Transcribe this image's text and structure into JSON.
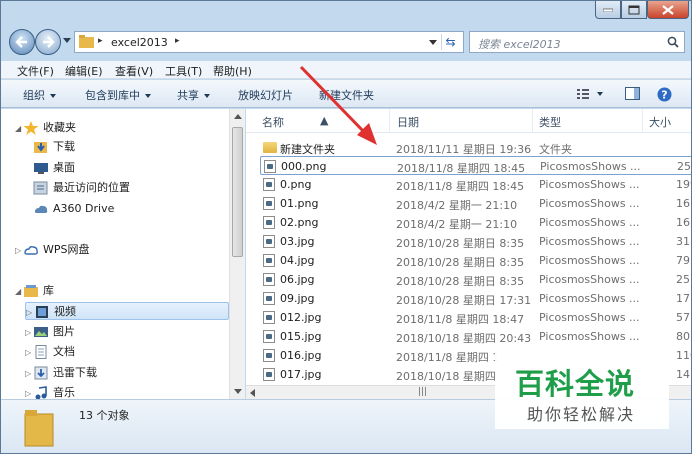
{
  "window": {
    "title_controls": [
      "minimize-icon",
      "maximize-icon",
      "close-icon"
    ]
  },
  "address": {
    "crumb": "excel2013",
    "sep": "▸"
  },
  "search": {
    "placeholder": "搜索 excel2013"
  },
  "menu": [
    "文件(F)",
    "编辑(E)",
    "查看(V)",
    "工具(T)",
    "帮助(H)"
  ],
  "toolbar": {
    "organize": "组织",
    "include": "包含到库中",
    "share": "共享",
    "slideshow": "放映幻灯片",
    "newfolder": "新建文件夹"
  },
  "nav": {
    "favorites": "收藏夹",
    "downloads": "下载",
    "desktop": "桌面",
    "recent": "最近访问的位置",
    "a360": "A360 Drive",
    "wps": "WPS网盘",
    "library": "库",
    "videos": "视频",
    "pictures": "图片",
    "documents": "文档",
    "thunder": "迅雷下载",
    "music": "音乐"
  },
  "columns": {
    "name": "名称",
    "date": "日期",
    "type": "类型",
    "size": "大小"
  },
  "files": [
    {
      "name": "新建文件夹",
      "date": "2018/11/11 星期日 19:36",
      "type": "文件夹",
      "size": ""
    },
    {
      "name": "000.png",
      "date": "2018/11/8 星期四 18:45",
      "type": "PicosmosShows ...",
      "size": "25"
    },
    {
      "name": "0.png",
      "date": "2018/11/8 星期四 18:45",
      "type": "PicosmosShows ...",
      "size": "199"
    },
    {
      "name": "01.png",
      "date": "2018/4/2 星期一 21:10",
      "type": "PicosmosShows ...",
      "size": "16"
    },
    {
      "name": "02.png",
      "date": "2018/4/2 星期一 21:10",
      "type": "PicosmosShows ...",
      "size": "16"
    },
    {
      "name": "03.jpg",
      "date": "2018/10/28 星期日 8:35",
      "type": "PicosmosShows ...",
      "size": "31"
    },
    {
      "name": "04.jpg",
      "date": "2018/10/28 星期日 8:35",
      "type": "PicosmosShows ...",
      "size": "79"
    },
    {
      "name": "06.jpg",
      "date": "2018/10/28 星期日 8:35",
      "type": "PicosmosShows ...",
      "size": "25"
    },
    {
      "name": "09.jpg",
      "date": "2018/10/28 星期日 17:31",
      "type": "PicosmosShows ...",
      "size": "17"
    },
    {
      "name": "012.jpg",
      "date": "2018/11/8 星期四 18:47",
      "type": "PicosmosShows ...",
      "size": "57"
    },
    {
      "name": "015.jpg",
      "date": "2018/10/18 星期四 20:43",
      "type": "PicosmosShows ...",
      "size": "80"
    },
    {
      "name": "016.jpg",
      "date": "2018/11/8 星期四 1",
      "type": "",
      "size": "110"
    },
    {
      "name": "017.jpg",
      "date": "2018/10/18 星期四",
      "type": "",
      "size": "14"
    }
  ],
  "status": {
    "count": "13 个对象"
  },
  "watermark": {
    "line1": "百科全说",
    "line2": "助你轻松解决"
  },
  "colors": {
    "accent": "#1f9e4a",
    "arrow": "#e03131"
  }
}
